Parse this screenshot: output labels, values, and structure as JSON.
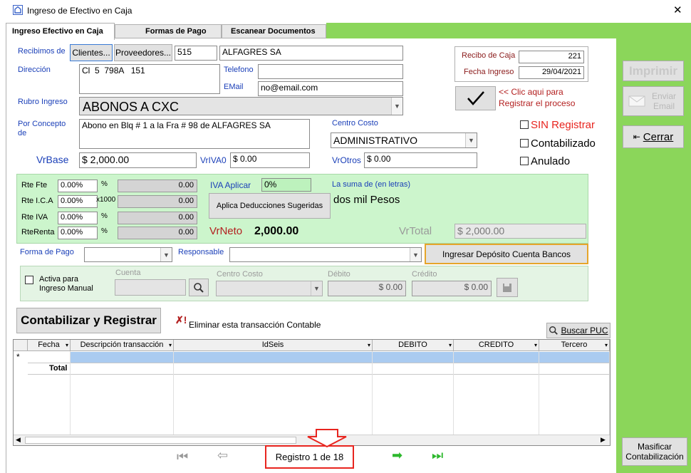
{
  "window": {
    "title": "Ingreso de Efectivo en Caja",
    "close_glyph": "✕"
  },
  "tabs": [
    {
      "label": "Ingreso Efectivo en Caja"
    },
    {
      "label": "Formas de Pago"
    },
    {
      "label": "Escanear Documentos"
    }
  ],
  "form": {
    "recibimos_label": "Recibimos de",
    "clientes_btn": "Clientes...",
    "proveedores_btn": "Proveedores...",
    "tercero_code": "515",
    "tercero_name": "ALFAGRES SA",
    "direccion_label": "Dirección",
    "direccion_value": "Cl  5  798A   151",
    "telefono_label": "Telefono",
    "telefono_value": "",
    "email_label": "EMail",
    "email_value": "no@email.com",
    "rubro_label": "Rubro Ingreso",
    "rubro_value": "ABONOS A CXC",
    "concepto_label": "Por Concepto de",
    "concepto_value": "Abono en Blq # 1 a la Fra # 98 de ALFAGRES SA",
    "centro_costo_label": "Centro Costo",
    "centro_costo_value": "ADMINISTRATIVO",
    "vrbase_label": "VrBase",
    "vrbase_value": "$ 2,000.00",
    "vriva0_label": "VrIVA0",
    "vriva0_value": "$ 0.00",
    "vrotros_label": "VrOtros",
    "vrotros_value": "$ 0.00"
  },
  "receipt": {
    "recibo_label": "Recibo de Caja",
    "recibo_value": "221",
    "fecha_label": "Fecha Ingreso",
    "fecha_value": "29/04/2021",
    "hint_line1": "<< Clic aqui para",
    "hint_line2": "Registrar el proceso"
  },
  "status": {
    "sin_registrar": "SIN Registrar",
    "contabilizado": "Contabilizado",
    "anulado": "Anulado"
  },
  "deductions": {
    "rows": [
      {
        "label": "Rte Fte",
        "pct": "0.00%",
        "unit": "%",
        "amount": "0.00"
      },
      {
        "label": "Rte I.C.A",
        "pct": "0.00%",
        "unit": "x1000",
        "amount": "0.00"
      },
      {
        "label": "Rte IVA",
        "pct": "0.00%",
        "unit": "%",
        "amount": "0.00"
      },
      {
        "label": "RteRenta",
        "pct": "0.00%",
        "unit": "%",
        "amount": "0.00"
      }
    ],
    "iva_aplicar_label": "IVA Aplicar",
    "iva_aplicar_value": "0%",
    "aplica_btn": "Aplica Deducciones Sugeridas",
    "suma_label": "La suma de (en letras)",
    "suma_value": "dos mil Pesos",
    "vrneto_label": "VrNeto",
    "vrneto_value": "2,000.00",
    "vrtotal_label": "VrTotal",
    "vrtotal_value": "$ 2,000.00"
  },
  "payment": {
    "forma_label": "Forma de Pago",
    "responsable_label": "Responsable",
    "ingresar_btn": "Ingresar Depósito Cuenta Bancos"
  },
  "manual": {
    "activa_label_1": "Activa para",
    "activa_label_2": "Ingreso Manual",
    "cuenta_label": "Cuenta",
    "centro_label": "Centro Costo",
    "debito_label": "Débito",
    "debito_value": "$ 0.00",
    "credito_label": "Crédito",
    "credito_value": "$ 0.00"
  },
  "actions": {
    "contabilizar_btn": "Contabilizar y Registrar",
    "eliminar_label": "Eliminar esta transacción Contable",
    "buscar_puc_btn": "Buscar PUC"
  },
  "grid": {
    "columns": [
      "Fecha",
      "Descripción transacción",
      "IdSeis",
      "DEBITO",
      "CREDITO",
      "Tercero"
    ],
    "new_row_marker": "*",
    "total_label": "Total"
  },
  "right_panel": {
    "imprimir": "Imprimir",
    "enviar_email": "Enviar Email",
    "cerrar": "Cerrar",
    "masificar_1": "Masificar",
    "masificar_2": "Contabilización"
  },
  "nav": {
    "record_text": "Registro 1 de 18"
  },
  "colors": {
    "accent_green": "#8bd65a",
    "panel_green": "#ccf5cc",
    "manual_panel": "#e4f4e4",
    "highlight_red": "#e8251f",
    "label_blue": "#1a3fb8"
  }
}
